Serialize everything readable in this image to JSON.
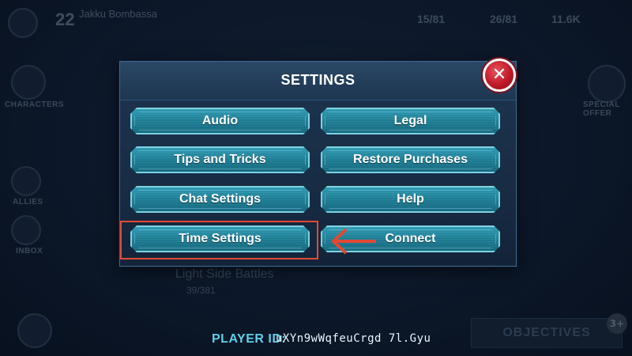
{
  "background": {
    "level": "22",
    "player_name": "Jakku Bombassa",
    "stats": [
      "15/81",
      "26/81",
      "11.6K"
    ],
    "side_labels": [
      "CHARACTERS",
      "ALLIES",
      "INBOX"
    ],
    "right_label": "SPECIAL OFFER",
    "battles_label": "Light Side Battles",
    "battles_progress": "39/381",
    "objectives_label": "OBJECTIVES",
    "objectives_badge": "3+"
  },
  "dialog": {
    "title": "SETTINGS",
    "buttons": {
      "audio": "Audio",
      "legal": "Legal",
      "tips": "Tips and Tricks",
      "restore": "Restore Purchases",
      "chat": "Chat Settings",
      "help": "Help",
      "time": "Time Settings",
      "connect": "Connect"
    },
    "close_icon": "close-icon"
  },
  "footer": {
    "player_id_label": "PLAYER ID:",
    "player_id_value": "uXYn9wWqfeuCrgd 7l.Gyu"
  },
  "colors": {
    "button_fill": "#1e7d94",
    "button_border": "#7fd2e0",
    "close_red": "#c01927",
    "highlight": "#e24a33",
    "player_id_label": "#5fd0ea"
  }
}
